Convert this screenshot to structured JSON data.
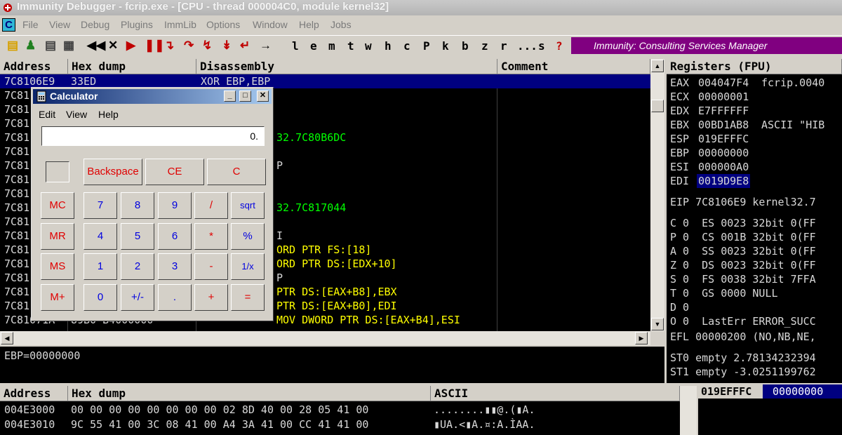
{
  "window": {
    "title": "Immunity Debugger - fcrip.exe - [CPU - thread 000004C0, module kernel32]"
  },
  "menu": {
    "app_icon": "C",
    "items": [
      "File",
      "View",
      "Debug",
      "Plugins",
      "ImmLib",
      "Options",
      "Window",
      "Help",
      "Jobs"
    ]
  },
  "toolbar": {
    "letters": [
      "l",
      "e",
      "m",
      "t",
      "w",
      "h",
      "c",
      "P",
      "k",
      "b",
      "z",
      "r",
      "...",
      "s",
      "?"
    ],
    "banner": "Immunity: Consulting Services Manager"
  },
  "cpu_pane": {
    "headers": {
      "address": "Address",
      "hex": "Hex dump",
      "disasm": "Disassembly",
      "comment": "Comment"
    },
    "rows": [
      {
        "addr": "7C8106E9",
        "hex": "33ED",
        "dis": "XOR EBP,EBP",
        "color": "w",
        "selected": true
      },
      {
        "addr": "7C81",
        "hex": "",
        "dis": "",
        "color": "w"
      },
      {
        "addr": "7C81",
        "hex": "",
        "dis": "",
        "color": "w"
      },
      {
        "addr": "7C81",
        "hex": "",
        "dis": "",
        "color": "w"
      },
      {
        "addr": "7C81",
        "hex": "",
        "dis": "32.7C80B6DC",
        "color": "g"
      },
      {
        "addr": "7C81",
        "hex": "",
        "dis": "",
        "color": "w"
      },
      {
        "addr": "7C81",
        "hex": "",
        "dis": "P",
        "color": "w"
      },
      {
        "addr": "7C81",
        "hex": "",
        "dis": "",
        "color": "w"
      },
      {
        "addr": "7C81",
        "hex": "",
        "dis": "",
        "color": "w"
      },
      {
        "addr": "7C81",
        "hex": "",
        "dis": "32.7C817044",
        "color": "g"
      },
      {
        "addr": "7C81",
        "hex": "",
        "dis": "",
        "color": "w"
      },
      {
        "addr": "7C81",
        "hex": "",
        "dis": "I",
        "color": "w"
      },
      {
        "addr": "7C81",
        "hex": "",
        "dis": "ORD PTR FS:[18]",
        "color": "y"
      },
      {
        "addr": "7C81",
        "hex": "",
        "dis": "ORD PTR DS:[EDX+10]",
        "color": "y"
      },
      {
        "addr": "7C81",
        "hex": "",
        "dis": "P",
        "color": "w"
      },
      {
        "addr": "7C81",
        "hex": "",
        "dis": "PTR DS:[EAX+B8],EBX",
        "color": "y"
      },
      {
        "addr": "7C81",
        "hex": "",
        "dis": "PTR DS:[EAX+B0],EDI",
        "color": "y"
      },
      {
        "addr": "7C81071A",
        "hex": "89B0 B4000000",
        "dis": "MOV DWORD PTR DS:[EAX+B4],ESI",
        "color": "y"
      }
    ]
  },
  "info_pane": {
    "text": "EBP=00000000"
  },
  "registers": {
    "header": "Registers (FPU)",
    "lines": [
      {
        "name": "EAX",
        "value": "004047F4",
        "note": "fcrip.0040"
      },
      {
        "name": "ECX",
        "value": "00000001",
        "note": ""
      },
      {
        "name": "EDX",
        "value": "E7FFFFFF",
        "note": ""
      },
      {
        "name": "EBX",
        "value": "00BD1AB8",
        "note": "ASCII \"HIB"
      },
      {
        "name": "ESP",
        "value": "019EFFFC",
        "note": ""
      },
      {
        "name": "EBP",
        "value": "00000000",
        "note": ""
      },
      {
        "name": "ESI",
        "value": "000000A0",
        "note": ""
      },
      {
        "name": "EDI",
        "value": "0019D9E8",
        "note": ""
      }
    ],
    "eip": "EIP 7C8106E9 kernel32.7",
    "flags": [
      "C 0  ES 0023 32bit 0(FF",
      "P 0  CS 001B 32bit 0(FF",
      "A 0  SS 0023 32bit 0(FF",
      "Z 0  DS 0023 32bit 0(FF",
      "S 0  FS 0038 32bit 7FFA",
      "T 0  GS 0000 NULL",
      "D 0",
      "O 0  LastErr ERROR_SUCC"
    ],
    "efl": "EFL 00000200 (NO,NB,NE,",
    "st0": "ST0 empty 2.78134232394",
    "st1": "ST1 empty -3.0251199762"
  },
  "dump_pane": {
    "headers": {
      "address": "Address",
      "hex": "Hex dump",
      "ascii": "ASCII"
    },
    "rows": [
      {
        "addr": "004E3000",
        "hex": "00 00 00 00 00 00 00 00 02 8D 40 00 28 05 41 00",
        "ascii": "........▮▮@.(▮A."
      },
      {
        "addr": "004E3010",
        "hex": "9C 55 41 00 3C 08 41 00 A4 3A 41 00 CC 41 41 00",
        "ascii": "▮UA.<▮A.¤:A.ÌAA."
      }
    ]
  },
  "stack_pane": {
    "addr": "019EFFFC",
    "value": "00000000"
  },
  "calculator": {
    "title": "Calculator",
    "menu": [
      "Edit",
      "View",
      "Help"
    ],
    "display": "0.",
    "buttons": {
      "backspace": "Backspace",
      "ce": "CE",
      "c": "C",
      "mc": "MC",
      "mr": "MR",
      "ms": "MS",
      "mplus": "M+",
      "seven": "7",
      "eight": "8",
      "nine": "9",
      "div": "/",
      "sqrt": "sqrt",
      "four": "4",
      "five": "5",
      "six": "6",
      "mul": "*",
      "pct": "%",
      "one": "1",
      "two": "2",
      "three": "3",
      "minus": "-",
      "inv": "1/x",
      "zero": "0",
      "sign": "+/-",
      "dot": ".",
      "plus": "+",
      "eq": "="
    }
  }
}
